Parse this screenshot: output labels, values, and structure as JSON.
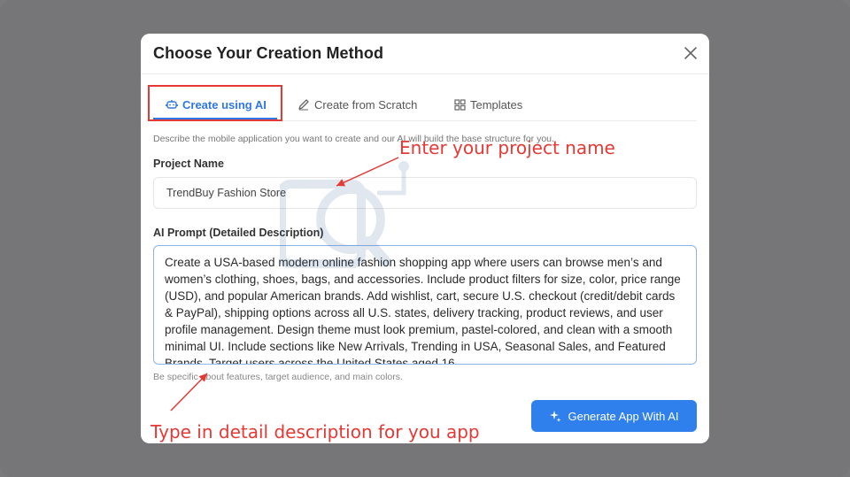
{
  "modal": {
    "title": "Choose Your Creation Method"
  },
  "tabs": [
    {
      "label": "Create using AI",
      "icon": "robot-icon",
      "active": true
    },
    {
      "label": "Create from Scratch",
      "icon": "pencil-icon",
      "active": false
    },
    {
      "label": "Templates",
      "icon": "grid-icon",
      "active": false
    }
  ],
  "form": {
    "description": "Describe the mobile application you want to create and our AI will build the base structure for you.",
    "project_label": "Project Name",
    "project_value": "TrendBuy Fashion Store",
    "prompt_label": "AI Prompt (Detailed Description)",
    "prompt_value": "Create a USA-based modern online fashion shopping app where users can browse men’s and women’s clothing, shoes, bags, and accessories. Include product filters for size, color, price range (USD), and popular American brands. Add wishlist, cart, secure U.S. checkout (credit/debit cards & PayPal), shipping options across all U.S. states, delivery tracking, product reviews, and user profile management. Design theme must look premium, pastel-colored, and clean with a smooth minimal UI. Include sections like New Arrivals, Trending in USA, Seasonal Sales, and Featured Brands. Target users across the United States aged 16",
    "hint": "Be specific about features, target audience, and main colors.",
    "generate_label": "Generate App With AI"
  },
  "annotations": {
    "project_name": "Enter your project name",
    "description": "Type in detail description for you app"
  },
  "colors": {
    "accent": "#2f80ed",
    "annotation": "#e53935"
  }
}
